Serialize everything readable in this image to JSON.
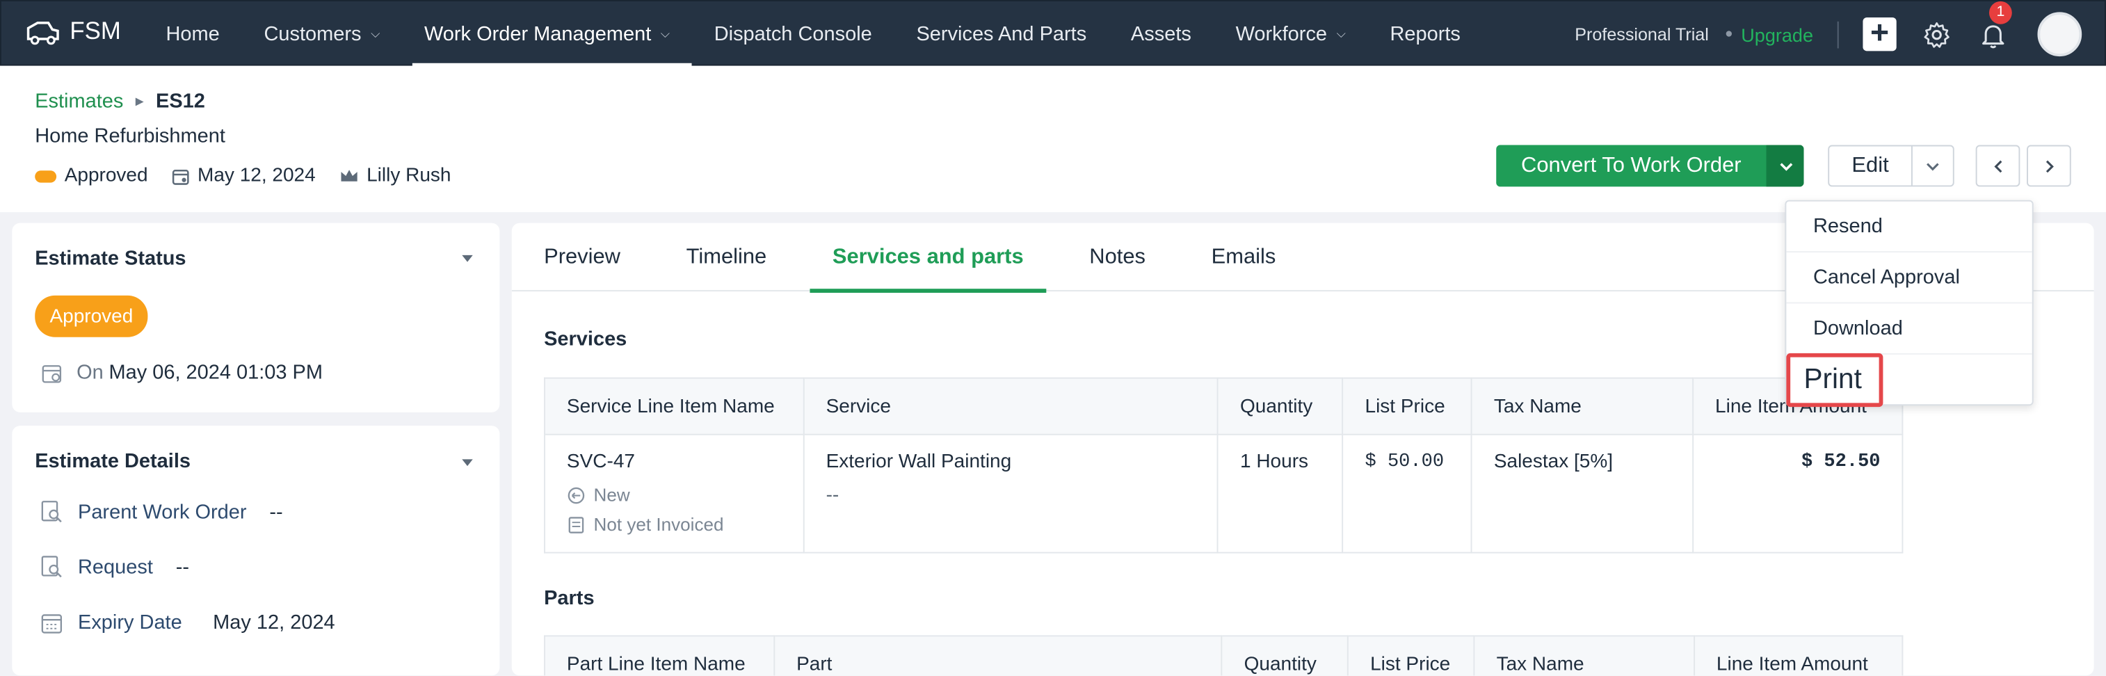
{
  "brand": {
    "logo_text": "FSM"
  },
  "nav": [
    {
      "label": "Home",
      "dropdown": false,
      "active": false
    },
    {
      "label": "Customers",
      "dropdown": true,
      "active": false
    },
    {
      "label": "Work Order Management",
      "dropdown": true,
      "active": true
    },
    {
      "label": "Dispatch Console",
      "dropdown": false,
      "active": false
    },
    {
      "label": "Services And Parts",
      "dropdown": false,
      "active": false
    },
    {
      "label": "Assets",
      "dropdown": false,
      "active": false
    },
    {
      "label": "Workforce",
      "dropdown": true,
      "active": false
    },
    {
      "label": "Reports",
      "dropdown": false,
      "active": false
    }
  ],
  "topright": {
    "trial": "Professional Trial",
    "upgrade": "Upgrade",
    "notification_count": "1"
  },
  "breadcrumb": {
    "parent": "Estimates",
    "current": "ES12"
  },
  "record": {
    "title": "Home Refurbishment",
    "status": "Approved",
    "date": "May 12, 2024",
    "owner": "Lilly Rush"
  },
  "actions": {
    "convert": "Convert To Work Order",
    "edit": "Edit"
  },
  "dropdown_menu": [
    "Resend",
    "Cancel Approval",
    "Download",
    "Print"
  ],
  "estimate_status": {
    "title": "Estimate Status",
    "status": "Approved",
    "on_label": "On",
    "on_value": "May 06, 2024 01:03 PM"
  },
  "estimate_details": {
    "title": "Estimate Details",
    "rows": [
      {
        "key": "Parent Work Order",
        "value": "--"
      },
      {
        "key": "Request",
        "value": "--"
      },
      {
        "key": "Expiry Date",
        "value": "May 12, 2024"
      }
    ]
  },
  "tabs": [
    "Preview",
    "Timeline",
    "Services and parts",
    "Notes",
    "Emails"
  ],
  "active_tab": "Services and parts",
  "services": {
    "title": "Services",
    "columns": [
      "Service Line Item Name",
      "Service",
      "Quantity",
      "List Price",
      "Tax Name",
      "Line Item Amount"
    ],
    "rows": [
      {
        "name": "SVC-47",
        "status": "New",
        "invoice": "Not yet Invoiced",
        "service": "Exterior Wall Painting",
        "service_sub": "--",
        "quantity": "1 Hours",
        "list_price": "$ 50.00",
        "tax": "Salestax [5%]",
        "amount": "$ 52.50"
      }
    ]
  },
  "parts": {
    "title": "Parts",
    "columns": [
      "Part Line Item Name",
      "Part",
      "Quantity",
      "List Price",
      "Tax Name",
      "Line Item Amount"
    ]
  },
  "colors": {
    "nav_bg": "#253343",
    "accent_green": "#1f9d57",
    "status_orange": "#f8a019",
    "highlight_red": "#e5474a"
  }
}
